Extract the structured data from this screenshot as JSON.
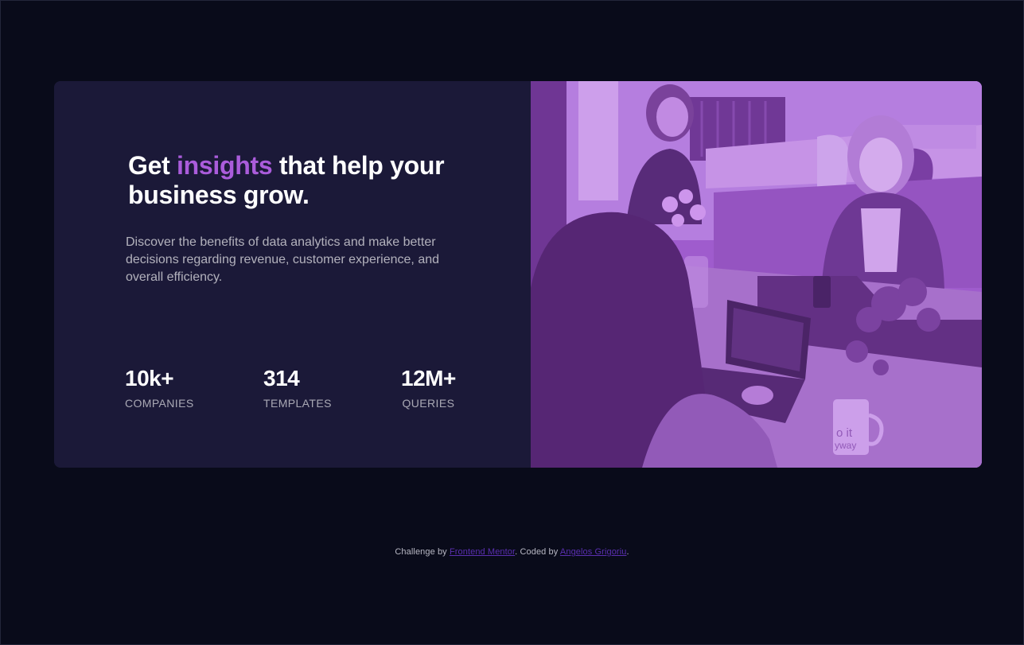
{
  "hero": {
    "title_before": "Get ",
    "title_accent": "insights",
    "title_after": " that help your business grow.",
    "description": "Discover the benefits of data analytics and make better decisions regarding revenue, customer experience, and overall efficiency."
  },
  "stats": [
    {
      "value": "10k+",
      "label": "COMPANIES"
    },
    {
      "value": "314",
      "label": "TEMPLATES"
    },
    {
      "value": "12M+",
      "label": "QUERIES"
    }
  ],
  "image": {
    "mug_text_1": "o it",
    "mug_text_2": "yway"
  },
  "footer": {
    "prefix": "Challenge by ",
    "challenge_link": "Frontend Mentor",
    "middle": ". Coded by ",
    "author_link": "Angelos Grigoriu",
    "suffix": "."
  },
  "colors": {
    "page_background": "#090b1a",
    "card_background": "#1b1938",
    "accent": "#aa5cdb",
    "link": "#5a2fb0"
  }
}
